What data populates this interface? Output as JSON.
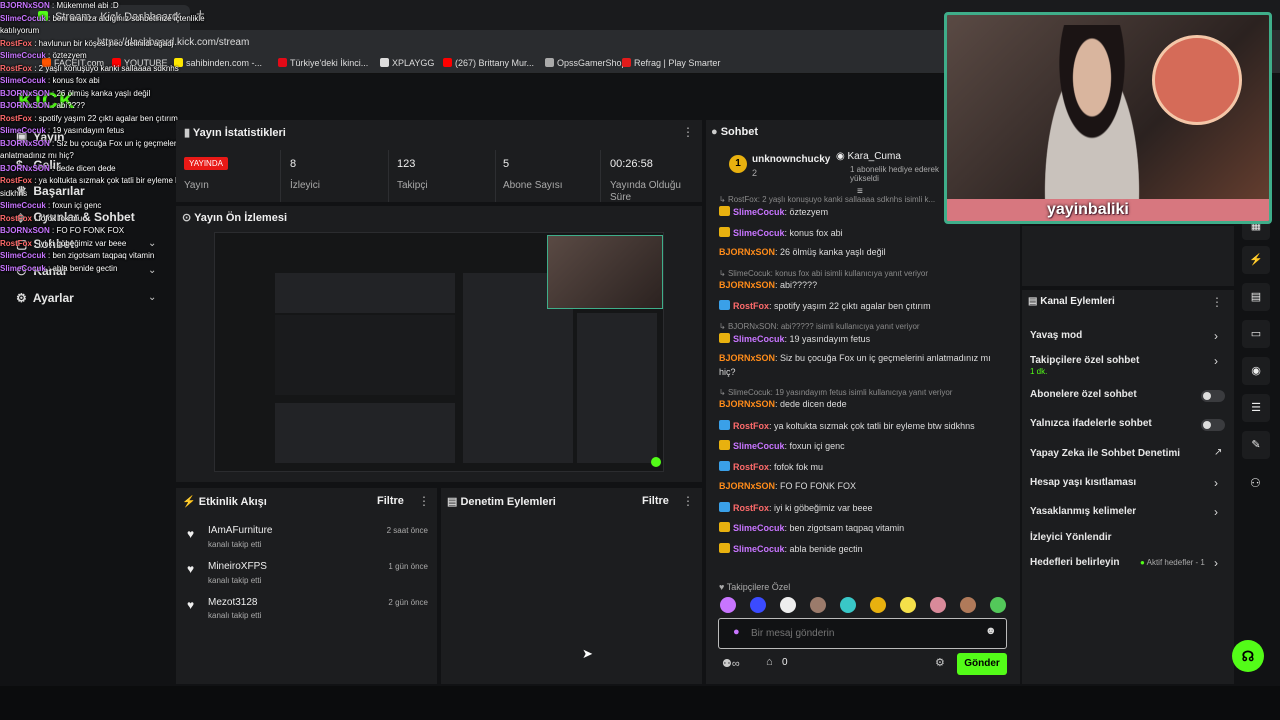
{
  "browser": {
    "tab_title": "Stream - Kick Dashboard",
    "url": "https://dashboard.kick.com/stream",
    "bookmarks": [
      {
        "label": "FACEIT.com",
        "color": "#ff5500"
      },
      {
        "label": "YOUTUBE",
        "color": "#ff0000"
      },
      {
        "label": "sahibinden.com -...",
        "color": "#ffe800"
      },
      {
        "label": "Türkiye'deki İkinci...",
        "color": "#e30a17"
      },
      {
        "label": "XPLAYGG",
        "color": "#dddddd"
      },
      {
        "label": "(267) Brittany Mur...",
        "color": "#ff0000"
      },
      {
        "label": "OpssGamerShop",
        "color": "#aaaaaa"
      },
      {
        "label": "Refrag | Play Smarter",
        "color": "#e21b1b"
      }
    ]
  },
  "overlay_chat": [
    {
      "user": "BJORNxSON",
      "text": "Mükemmel abi :D"
    },
    {
      "user": "SlimeCocuk",
      "text": "beni aranıza aldığınız sohbetinize içtenlikle katılıyorum"
    },
    {
      "user": "RostFox",
      "text": "havlunun bir köşesi neo delinildi ağadj"
    },
    {
      "user": "SlimeCocuk",
      "text": "öztezyem"
    },
    {
      "user": "RostFox",
      "text": "2 yaşlı konuşuyo kanki sallaaaa sdknhs"
    },
    {
      "user": "SlimeCocuk",
      "text": "konus fox abi"
    },
    {
      "user": "BJORNxSON",
      "text": "26 ölmüş kanka yaşlı değil"
    },
    {
      "user": "BJORNxSON",
      "text": "abi????"
    },
    {
      "user": "RostFox",
      "text": "spotify yaşım 22 çıktı agalar ben çıtırım"
    },
    {
      "user": "SlimeCocuk",
      "text": "19 yasındayım fetus"
    },
    {
      "user": "BJORNxSON",
      "text": "Siz bu çocuğa Fox un iç geçmelerini anlatmadınız mı hiç?"
    },
    {
      "user": "BJORNxSON",
      "text": "dede dicen dede"
    },
    {
      "user": "RostFox",
      "text": "ya koltukta sızmak çok tatli bir eyleme btw sidkhns"
    },
    {
      "user": "SlimeCocuk",
      "text": "foxun içi genc"
    },
    {
      "user": "RostFox",
      "text": "fofok fok mu"
    },
    {
      "user": "BJORNxSON",
      "text": "FO FO FONK FOX"
    },
    {
      "user": "RostFox",
      "text": "iyi ki göbeğimiz var beee"
    },
    {
      "user": "SlimeCocuk",
      "text": "ben zigotsam taqpaq vitamin"
    },
    {
      "user": "SlimeCocuk",
      "text": "abla benide gectin"
    }
  ],
  "nav": {
    "items": [
      "Yayın",
      "Gelir",
      "Başarılar",
      "Oyunlar & Sohbet",
      "Sohbet",
      "Kanal",
      "Ayarlar"
    ],
    "logo": "KICK"
  },
  "stats": {
    "title": "Yayın İstatistikleri",
    "live_badge": "YAYINDA",
    "items": [
      {
        "value": "8",
        "label": "İzleyici"
      },
      {
        "value": "123",
        "label": "Takipçi"
      },
      {
        "value": "5",
        "label": "Abone Sayısı"
      },
      {
        "value": "00:26:58",
        "label": "Yayında Olduğu Süre"
      }
    ],
    "first_label": "Yayın"
  },
  "preview": {
    "title": "Yayın Ön İzlemesi"
  },
  "activity": {
    "title": "Etkinlik Akışı",
    "filter": "Filtre",
    "items": [
      {
        "name": "IAmAFurniture",
        "sub": "kanalı takip etti",
        "time": "2 saat önce"
      },
      {
        "name": "MineiroXFPS",
        "sub": "kanalı takip etti",
        "time": "1 gün önce"
      },
      {
        "name": "Mezot3128",
        "sub": "kanalı takip etti",
        "time": "2 gün önce"
      }
    ]
  },
  "moderation": {
    "title": "Denetim Eylemleri",
    "filter": "Filtre"
  },
  "chat": {
    "title": "Sohbet",
    "top_gifter": "unknownchucky",
    "top_gifter_count": "2",
    "sub_gifter": "Kara_Cuma",
    "sub_gift_text": "1 abonelik hediye ederek yükseldi",
    "messages": [
      {
        "type": "reply",
        "text": "RostFox: 2 yaşlı konuşuyo kanki sallaaaa sdknhs isimli k..."
      },
      {
        "type": "msg",
        "user": "SlimeCocuk",
        "cls": "sm",
        "text": "öztezyem"
      },
      {
        "type": "msg",
        "user": "SlimeCocuk",
        "cls": "sm",
        "text": "konus fox abi"
      },
      {
        "type": "msg",
        "user": "BJORNxSON",
        "cls": "bj",
        "text": "26 ölmüş kanka yaşlı değil"
      },
      {
        "type": "reply",
        "text": "SlimeCocuk: konus fox abi isimli kullanıcıya yanıt veriyor"
      },
      {
        "type": "msg",
        "user": "BJORNxSON",
        "cls": "bj",
        "text": "abi?????"
      },
      {
        "type": "msg",
        "user": "RostFox",
        "cls": "rf",
        "text": "spotify yaşım 22 çıktı agalar ben çıtırım"
      },
      {
        "type": "reply",
        "text": "BJORNxSON: abi????? isimli kullanıcıya yanıt veriyor"
      },
      {
        "type": "msg",
        "user": "SlimeCocuk",
        "cls": "sm",
        "text": "19 yasındayım fetus"
      },
      {
        "type": "msg",
        "user": "BJORNxSON",
        "cls": "bj",
        "text": "Siz bu çocuğa Fox un iç geçmelerini anlatmadınız mı"
      },
      {
        "type": "cont",
        "text": "hiç?"
      },
      {
        "type": "reply",
        "text": "SlimeCocuk: 19 yasındayım fetus isimli kullanıcıya yanıt veriyor"
      },
      {
        "type": "msg",
        "user": "BJORNxSON",
        "cls": "bj",
        "text": "dede dicen dede"
      },
      {
        "type": "msg",
        "user": "RostFox",
        "cls": "rf",
        "text": "ya koltukta sızmak çok tatli bir eyleme btw sidkhns"
      },
      {
        "type": "msg",
        "user": "SlimeCocuk",
        "cls": "sm",
        "text": "foxun içi genc"
      },
      {
        "type": "msg",
        "user": "RostFox",
        "cls": "rf",
        "text": "fofok fok mu"
      },
      {
        "type": "msg",
        "user": "BJORNxSON",
        "cls": "bj",
        "text": "FO FO FONK FOX"
      },
      {
        "type": "msg",
        "user": "RostFox",
        "cls": "rf",
        "text": "iyi ki göbeğimiz var beee"
      },
      {
        "type": "msg",
        "user": "SlimeCocuk",
        "cls": "sm",
        "text": "ben zigotsam taqpaq vitamin"
      },
      {
        "type": "msg",
        "user": "SlimeCocuk",
        "cls": "sm",
        "text": "abla benide gectin"
      }
    ],
    "emote_header": "Takipçilere Özel",
    "placeholder": "Bir mesaj gönderin",
    "count": "0",
    "send": "Gönder"
  },
  "channel_actions": {
    "title": "Kanal Eylemleri",
    "items": [
      {
        "label": "Yavaş mod",
        "ctrl": "chev"
      },
      {
        "label": "Takipçilere özel sohbet",
        "ctrl": "chev",
        "sub": "1 dk."
      },
      {
        "label": "Abonelere özel sohbet",
        "ctrl": "toggle"
      },
      {
        "label": "Yalnızca ifadelerle sohbet",
        "ctrl": "toggle"
      },
      {
        "label": "Yapay Zeka ile Sohbet Denetimi",
        "ctrl": "ext"
      },
      {
        "label": "Hesap yaşı kısıtlaması",
        "ctrl": "chev"
      },
      {
        "label": "Yasaklanmış kelimeler",
        "ctrl": "chev"
      },
      {
        "label": "İzleyici Yönlendir",
        "ctrl": "none"
      },
      {
        "label": "Hedefleri belirleyin",
        "ctrl": "chev",
        "extra": "Aktif hedefler - 1"
      }
    ]
  },
  "webcam": {
    "name": "yayinbaliki"
  },
  "colors": {
    "accent": "#53fc18",
    "live": "#e91916",
    "panel": "#1c1d1f",
    "bg": "#111214"
  }
}
